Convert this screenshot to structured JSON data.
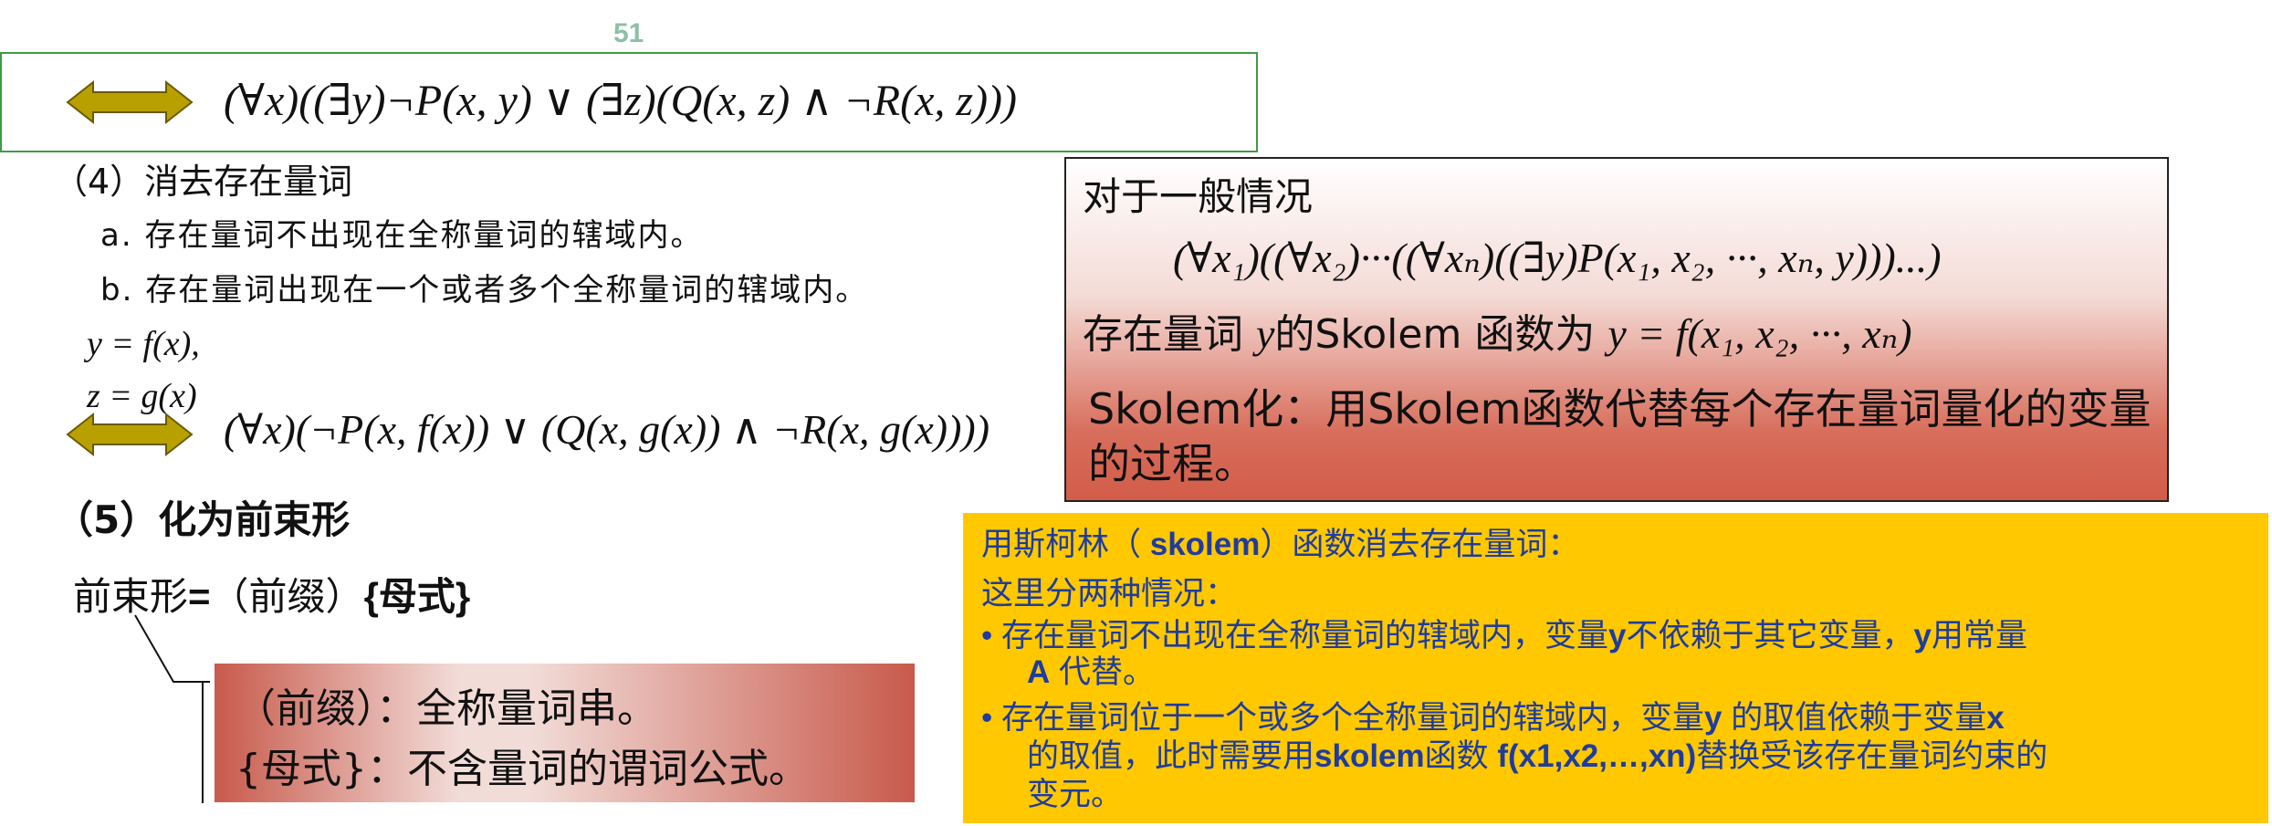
{
  "page_number": "51",
  "formula_1": "(∀x)((∃y)¬P(x, y) ∨ (∃z)(Q(x, z) ∧ ¬R(x, z)))",
  "step4": {
    "title": "（4）消去存在量词",
    "item_a": "a.  存在量词不出现在全称量词的辖域内。",
    "item_b": "b.  存在量词出现在一个或者多个全称量词的辖域内。",
    "sub1": "y = f(x),",
    "sub2": "z = g(x)",
    "formula_2": "(∀x)(¬P(x, f(x)) ∨ (Q(x, g(x)) ∧ ¬R(x, g(x))))"
  },
  "step5": {
    "title": "（5）化为前束形",
    "prenex_label": "前束形",
    "prenex_eq": "=",
    "prenex_prefix": "（前缀）",
    "prenex_matrix": "{母式}",
    "red_line_1": "（前缀）：全称量词串。",
    "red_line_2": "{母式}：不含量词的谓词公式。"
  },
  "skolem_box": {
    "title": "对于一般情况",
    "formula": "(∀x₁)((∀x₂)···((∀xₙ)((∃y)P(x₁, x₂, ···, xₙ, y)))...)",
    "line_prefix": "存在量词 ",
    "line_var": "y",
    "line_mid": "的Skolem 函数为  ",
    "line_func": "y = f(x₁, x₂, ···, xₙ)",
    "description": "Skolem化：用Skolem函数代替每个存在量词量化的变量的过程。"
  },
  "yellow_box": {
    "l1a": "用斯柯林（ ",
    "l1b": "skolem",
    "l1c": "）函数消去存在量词：",
    "l2": "这里分两种情况：",
    "bullet": "•",
    "b1a": "存在量词不出现在全称量词的辖域内，变量",
    "b1b": "y",
    "b1c": "不依赖于其它变量，",
    "b1d": "y",
    "b1e": "用常量",
    "b1f": "A",
    "b1g": " 代替。",
    "b2a": "存在量词位于一个或多个全称量词的辖域内，变量",
    "b2b": "y",
    "b2c": " 的取值依赖于变量",
    "b2d": "x",
    "b2e": "的取值，此时需要用",
    "b2f": "skolem",
    "b2g": "函数 ",
    "b2h": "f(x1,x2,…,xn)",
    "b2i": "替换受该存在量词约束的",
    "b2j": "变元。"
  },
  "colors": {
    "frame_green": "#3f9a45",
    "arrow_olive": "#b8a000",
    "yellow_bg": "#ffc800",
    "blue_text": "#1f3c9e",
    "red_fill": "#c85a4c"
  }
}
